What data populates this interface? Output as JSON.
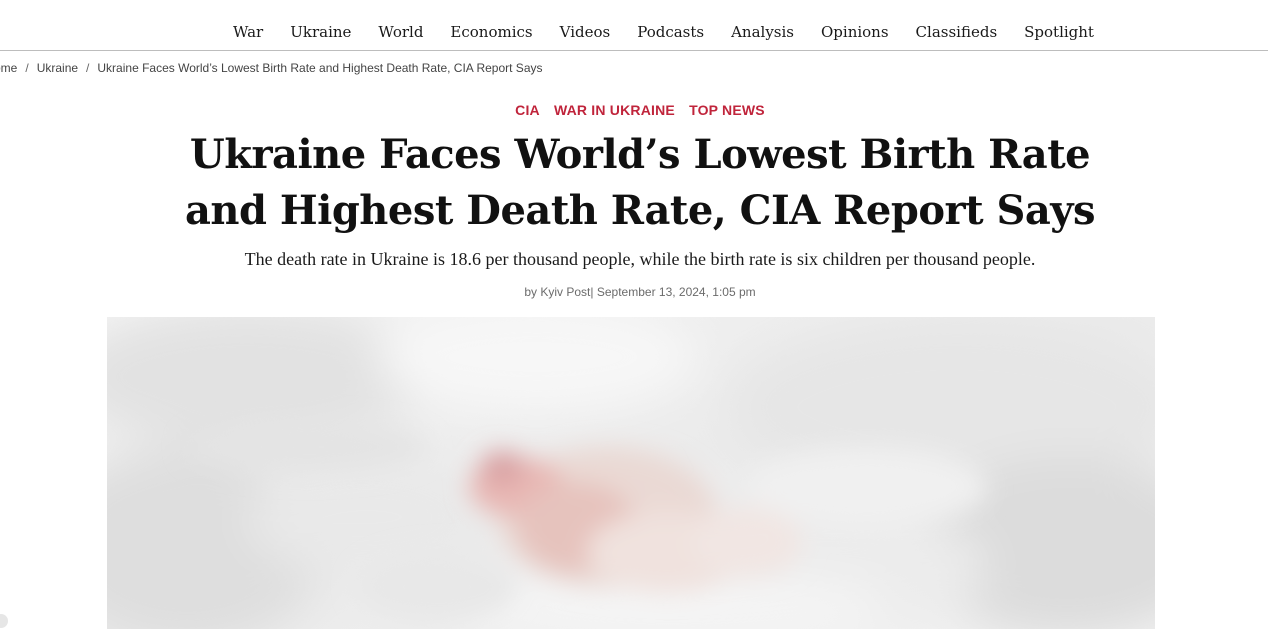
{
  "nav": {
    "items": [
      "War",
      "Ukraine",
      "World",
      "Economics",
      "Videos",
      "Podcasts",
      "Analysis",
      "Opinions",
      "Classifieds",
      "Spotlight"
    ]
  },
  "breadcrumb": {
    "home": "ome",
    "section": "Ukraine",
    "current": "Ukraine Faces World’s Lowest Birth Rate and Highest Death Rate, CIA Report Says",
    "separator": "/"
  },
  "article": {
    "tags": [
      "CIA",
      "WAR IN UKRAINE",
      "TOP NEWS"
    ],
    "headline_line1": "Ukraine Faces World’s Lowest Birth Rate",
    "headline_line2": "and Highest Death Rate, CIA Report Says",
    "subheadline": "The death rate in Ukraine is 18.6 per thousand people, while the birth rate is six children per thousand people.",
    "byline_prefix": "by",
    "author": "Kyiv Post",
    "byline_separator": "|",
    "date": "September 13, 2024, 1:05 pm"
  },
  "colors": {
    "tag_accent": "#c0243b",
    "headline": "#111111",
    "meta_text": "#6b6b6b"
  }
}
